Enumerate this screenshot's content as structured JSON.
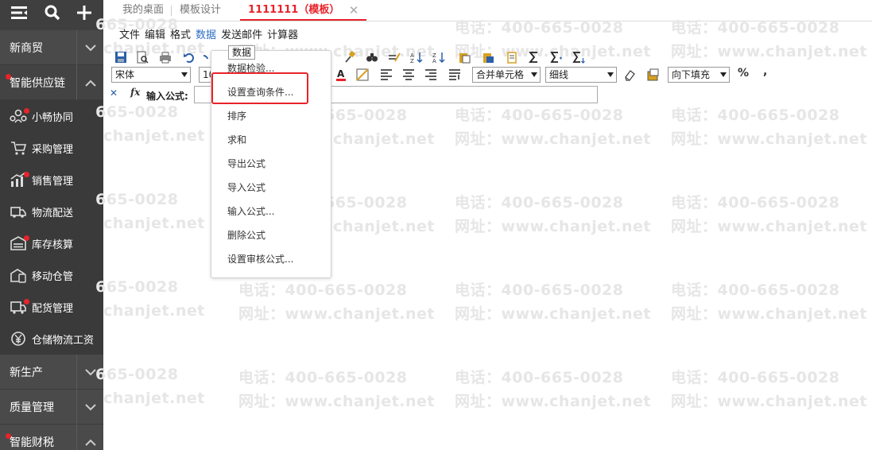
{
  "sidebar": {
    "sections": [
      {
        "label": "新商贸"
      },
      {
        "label": "智能供应链"
      },
      {
        "label": "新生产"
      },
      {
        "label": "质量管理"
      },
      {
        "label": "智能财税"
      }
    ],
    "items": [
      {
        "label": "小畅协同"
      },
      {
        "label": "采购管理"
      },
      {
        "label": "销售管理"
      },
      {
        "label": "物流配送"
      },
      {
        "label": "库存核算"
      },
      {
        "label": "移动仓管"
      },
      {
        "label": "配货管理"
      },
      {
        "label": "仓储物流工资"
      }
    ]
  },
  "tabs": [
    {
      "label": "我的桌面"
    },
    {
      "label": "模板设计"
    },
    {
      "label": "1111111（模板）"
    }
  ],
  "tab_close": "✕",
  "menubar": [
    "文件",
    "编辑",
    "格式",
    "数据",
    "发送邮件",
    "计算器"
  ],
  "toolbar": {
    "font_family": "宋体",
    "font_size": "10",
    "merge": "合并单元格",
    "border": "细线",
    "fill": "向下填充",
    "percent": "%",
    "comma": ","
  },
  "formula": {
    "label": "输入公式:",
    "fx": "fx",
    "cancel": "✕"
  },
  "tooltip": "数据",
  "dropdown": [
    "数据检验...",
    "设置查询条件...",
    "排序",
    "求和",
    "导出公式",
    "导入公式",
    "输入公式...",
    "删除公式",
    "设置审核公式..."
  ],
  "watermark": {
    "phone": "电话：400-665-0028",
    "site": "网址：www.chanjet.net",
    "phone_partial": "665-0028",
    "site_partial": "chanjet.net"
  },
  "colors": {
    "accent": "#e8232a",
    "sidebar": "#3f3f3f",
    "link": "#2d6fc4"
  }
}
